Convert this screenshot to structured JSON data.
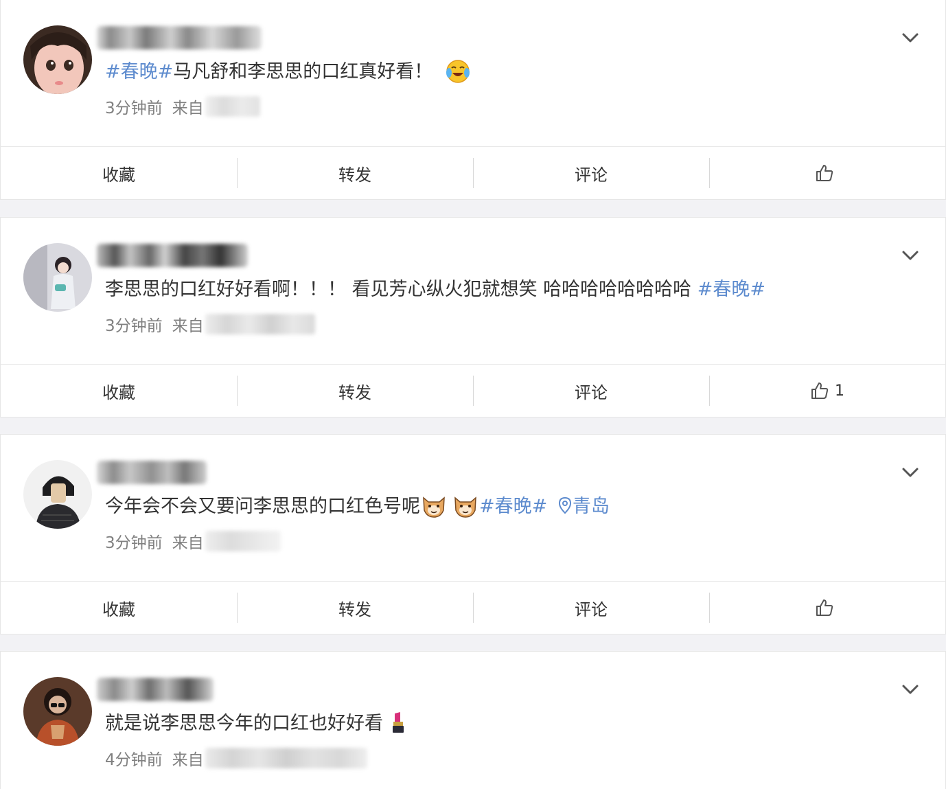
{
  "actions": {
    "favorite": "收藏",
    "repost": "转发",
    "comment": "评论"
  },
  "posts": [
    {
      "username": "",
      "segments": [
        {
          "text": "#春晚#",
          "type": "tag"
        },
        {
          "text": "马凡舒和李思思的口红真好看！",
          "type": "text"
        }
      ],
      "emoji": "tears-of-joy-emoji",
      "time": "3分钟前",
      "from_label": "来自",
      "like_count": ""
    },
    {
      "username": "",
      "segments": [
        {
          "text": "李思思的口红好好看啊！！！ 看见芳心纵火犯就想笑 哈哈哈哈哈哈哈哈 ",
          "type": "text"
        },
        {
          "text": "#春晚#",
          "type": "tag"
        }
      ],
      "time": "3分钟前",
      "from_label": "来自",
      "like_count": "1"
    },
    {
      "username": "",
      "segments_before": "今年会不会又要问李思思的口红色号呢",
      "emoji": "cat-face-emoji",
      "tag": "#春晚#",
      "location": "青岛",
      "time": "3分钟前",
      "from_label": "来自",
      "like_count": ""
    },
    {
      "username": "",
      "text": "就是说李思思今年的口红也好好看",
      "emoji": "lipstick-emoji",
      "time": "4分钟前",
      "from_label": "来自",
      "like_count": ""
    }
  ],
  "colors": {
    "tag": "#5d8bce",
    "meta": "#808080",
    "background": "#f2f2f5"
  }
}
